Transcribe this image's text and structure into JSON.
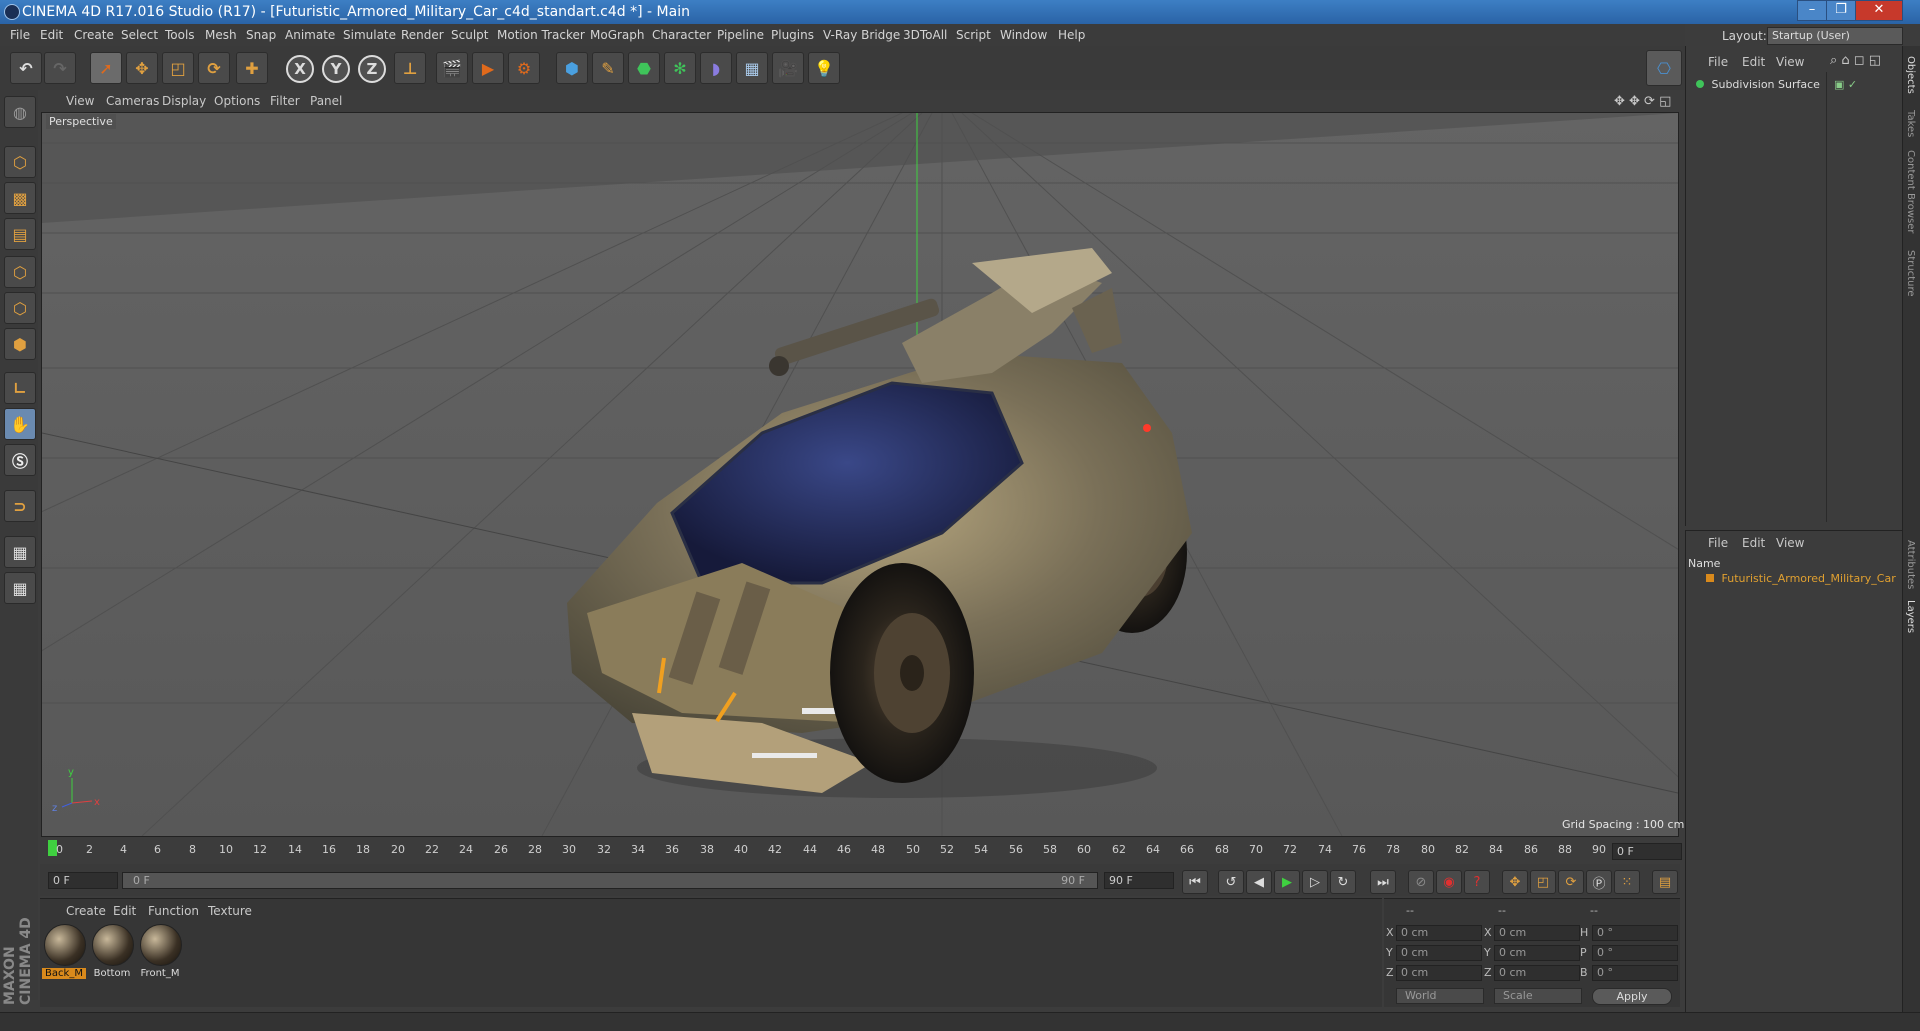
{
  "window": {
    "title": "CINEMA 4D R17.016 Studio (R17) - [Futuristic_Armored_Military_Car_c4d_standart.c4d *] - Main",
    "buttons": {
      "minimize": "–",
      "maximize": "❐",
      "close": "✕"
    }
  },
  "menubar": {
    "items": [
      "File",
      "Edit",
      "Create",
      "Select",
      "Tools",
      "Mesh",
      "Snap",
      "Animate",
      "Simulate",
      "Render",
      "Sculpt",
      "Motion Tracker",
      "MoGraph",
      "Character",
      "Pipeline",
      "Plugins",
      "V-Ray Bridge",
      "3DToAll",
      "Script",
      "Window",
      "Help"
    ],
    "layout_label": "Layout:",
    "layout_value": "Startup (User)"
  },
  "toolbar": {
    "axis_x": "X",
    "axis_y": "Y",
    "axis_z": "Z"
  },
  "viewport": {
    "menu": [
      "View",
      "Cameras",
      "Display",
      "Options",
      "Filter",
      "Panel"
    ],
    "camera_label": "Perspective",
    "grid_spacing": "Grid Spacing : 100 cm",
    "axis_labels": {
      "x": "x",
      "y": "y",
      "z": "z"
    }
  },
  "timeline": {
    "ticks": [
      "0",
      "2",
      "4",
      "6",
      "8",
      "10",
      "12",
      "14",
      "16",
      "18",
      "20",
      "22",
      "24",
      "26",
      "28",
      "30",
      "32",
      "34",
      "36",
      "38",
      "40",
      "42",
      "44",
      "46",
      "48",
      "50",
      "52",
      "54",
      "56",
      "58",
      "60",
      "62",
      "64",
      "66",
      "68",
      "70",
      "72",
      "74",
      "76",
      "78",
      "80",
      "82",
      "84",
      "86",
      "88",
      "90"
    ],
    "current_frame": "0 F",
    "start_field": "0 F",
    "range_start": "0 F",
    "range_end": "90 F",
    "end_field": "90 F"
  },
  "materials": {
    "menu": [
      "Create",
      "Edit",
      "Function",
      "Texture"
    ],
    "items": [
      {
        "name": "Back_M",
        "selected": true
      },
      {
        "name": "Bottom",
        "selected": false
      },
      {
        "name": "Front_M",
        "selected": false
      }
    ]
  },
  "coordinates": {
    "header": [
      "--",
      "--",
      "--"
    ],
    "rows": [
      {
        "a": "X",
        "av": "0 cm",
        "b": "X",
        "bv": "0 cm",
        "c": "H",
        "cv": "0 °"
      },
      {
        "a": "Y",
        "av": "0 cm",
        "b": "Y",
        "bv": "0 cm",
        "c": "P",
        "cv": "0 °"
      },
      {
        "a": "Z",
        "av": "0 cm",
        "b": "Z",
        "bv": "0 cm",
        "c": "B",
        "cv": "0 °"
      }
    ],
    "world": "World",
    "scale": "Scale",
    "apply": "Apply"
  },
  "objects_panel": {
    "menu": [
      "File",
      "Edit",
      "View"
    ],
    "items": [
      "Subdivision Surface"
    ]
  },
  "layers_panel": {
    "menu": [
      "File",
      "Edit",
      "View"
    ],
    "name_header": "Name",
    "items": [
      "Futuristic_Armored_Military_Car"
    ]
  },
  "side_tabs": [
    "Objects",
    "Takes",
    "Content Browser",
    "Structure",
    "Attributes",
    "Layers"
  ],
  "branding": "MAXON CINEMA 4D",
  "colors": {
    "accent": "#d98a1c",
    "title_bar": "#2f6db2",
    "close": "#c7392b"
  }
}
